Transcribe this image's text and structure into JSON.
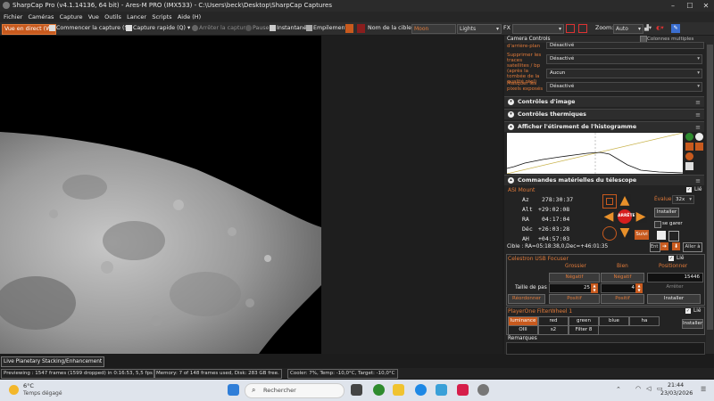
{
  "window": {
    "title": "SharpCap Pro (v4.1.14136, 64 bit) - Ares-M PRO (IMX533) - C:\\Users\\beck\\Desktop\\SharpCap Captures"
  },
  "menu": [
    "Fichier",
    "Caméras",
    "Capture",
    "Vue",
    "Outils",
    "Lancer",
    "Scripts",
    "Aide (H)"
  ],
  "toolbar": {
    "live": "Vue en direct (W)",
    "start": "Commencer la capture (S)",
    "quick": "Capture rapide (Q)",
    "stop": "Arrêter la capture",
    "pause": "Pause",
    "snapshot": "Instantané",
    "stack": "Empilement",
    "target_label": "Nom de la cible:",
    "target_value": "Moon",
    "frame_type": "Lights",
    "fx_label": "FX",
    "zoom_label": "Zoom:",
    "zoom_value": "Auto"
  },
  "panel": {
    "camera_controls": "Camera Controls",
    "multi_columns": "Colonnes multiples",
    "rows": [
      {
        "label": "d'arrière-plan",
        "value": "Désactivé"
      },
      {
        "label": "Supprimer les traces satellites / bp (après la tombée de la qualité réel)",
        "value": "Désactivé"
      },
      {
        "label": "",
        "value": "Aucun"
      },
      {
        "label": "Masquer les pixels exposés",
        "value": "Désactivé"
      }
    ],
    "sections": {
      "image": "Contrôles d'image",
      "thermal": "Contrôles thermiques",
      "histogram": "Afficher l'étirement de l'histogramme",
      "telescope": "Commandes matérielles du télescope"
    },
    "mount": {
      "name": "ASI Mount",
      "az_label": "Az",
      "az": "278:30:37",
      "alt_label": "Alt",
      "alt": "+29:02:08",
      "ra_label": "RA",
      "ra": "04:17:04",
      "dec_label": "Déc",
      "dec": "+26:03:28",
      "ah_label": "AH",
      "ah": "+04:57:03",
      "evaluer_label": "Évaluer:",
      "rate": "32x",
      "lie": "Lié",
      "installer": "Installer",
      "se_garer": "se garer",
      "stop": "ARRÊTER",
      "suivi": "Suivi",
      "cible": "Cible : RA=05:18:38,0,Dec=+46:01:35",
      "aller": "Aller à"
    },
    "focuser": {
      "name": "Celestron USB Focuser",
      "lie": "Lié",
      "grossier": "Grossier",
      "bien": "Bien",
      "positionner": "Positionner",
      "negatif": "Négatif",
      "position": "15446",
      "pas_label": "Taille de pas",
      "pas_grossier": "25",
      "pas_bien": "4",
      "arreter": "Arrêter",
      "positif": "Positif",
      "reordonner": "Réordonner",
      "installer": "Installer"
    },
    "filterwheel": {
      "name": "PlayerOne FilterWheel 1",
      "lie": "Lié",
      "filters": [
        "luminance",
        "red",
        "green",
        "blue",
        "ha",
        "OIII",
        "s2",
        "Filter 8"
      ],
      "installer": "Installer"
    },
    "remarques": "Remarques"
  },
  "stacking_label": "Live Planetary Stacking/Enhancement",
  "status": {
    "preview": "Previewing : 1547 frames (1599 dropped) in 0:16:53, 5,5 fps",
    "memory": "Memory: 7 of 148 frames used, Disk: 283 GB free.",
    "cooler": "Cooler: 7%, Temp: -10,0°C, Target: -10,0°C"
  },
  "taskbar": {
    "temp": "6°C",
    "weather": "Temps dégagé",
    "search": "Rechercher",
    "time": "21:44",
    "date": "23/03/2026"
  },
  "colors": {
    "accent": "#c85a1e",
    "label": "#e07a3a",
    "panel_bg": "#232323"
  }
}
